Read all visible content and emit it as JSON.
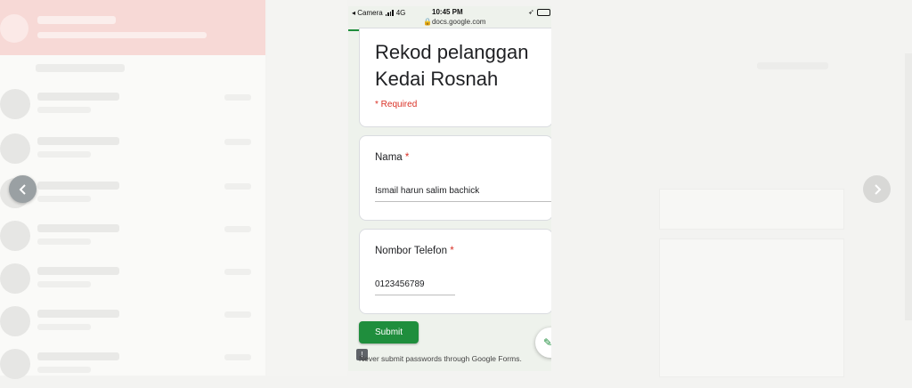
{
  "phone": {
    "status": {
      "carrier": "◂ Camera",
      "network": "4G",
      "time": "10:45 PM",
      "url": "docs.google.com"
    },
    "form": {
      "title": "Rekod pelanggan Kedai Rosnah",
      "required_note": "* Required",
      "questions": [
        {
          "label": "Nama",
          "required_mark": "*",
          "answer": "Ismail harun salim bachick"
        },
        {
          "label": "Nombor Telefon",
          "required_mark": "*",
          "answer": "0123456789"
        }
      ],
      "submit_label": "Submit",
      "warning": "Never submit passwords through Google Forms."
    }
  },
  "icons": {
    "prev": "chevron-left-icon",
    "next": "chevron-right-icon",
    "edit": "pencil-icon",
    "warning": "report-icon",
    "lock": "lock-icon"
  },
  "colors": {
    "accent": "#1f8e3d",
    "required": "#d93025"
  }
}
